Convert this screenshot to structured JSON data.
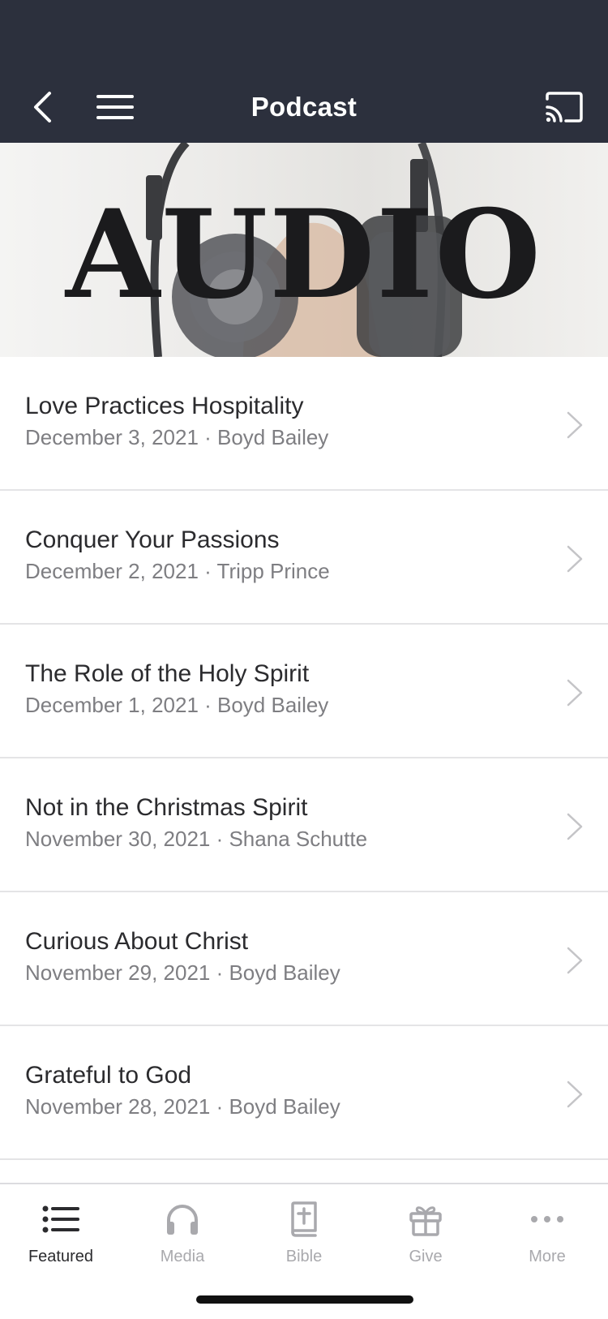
{
  "header": {
    "title": "Podcast",
    "background": "#2c303d"
  },
  "hero": {
    "text": "AUDIO"
  },
  "episodes": [
    {
      "title": "Love Practices Hospitality",
      "meta": "December 3, 2021 · Boyd Bailey"
    },
    {
      "title": "Conquer Your Passions",
      "meta": "December 2, 2021 · Tripp Prince"
    },
    {
      "title": "The Role of the Holy Spirit",
      "meta": "December 1, 2021 · Boyd Bailey"
    },
    {
      "title": "Not in the Christmas Spirit",
      "meta": "November 30, 2021 · Shana Schutte"
    },
    {
      "title": "Curious About Christ",
      "meta": "November 29, 2021 · Boyd Bailey"
    },
    {
      "title": "Grateful to God",
      "meta": "November 28, 2021 · Boyd Bailey"
    }
  ],
  "tabs": [
    {
      "label": "Featured",
      "icon": "list-icon",
      "active": true
    },
    {
      "label": "Media",
      "icon": "headphones-icon",
      "active": false
    },
    {
      "label": "Bible",
      "icon": "bible-icon",
      "active": false
    },
    {
      "label": "Give",
      "icon": "gift-icon",
      "active": false
    },
    {
      "label": "More",
      "icon": "more-dots-icon",
      "active": false
    }
  ],
  "colors": {
    "active_tab": "#2b2b2e",
    "inactive_tab": "#a9a9ad",
    "meta_text": "#7e7e82"
  }
}
